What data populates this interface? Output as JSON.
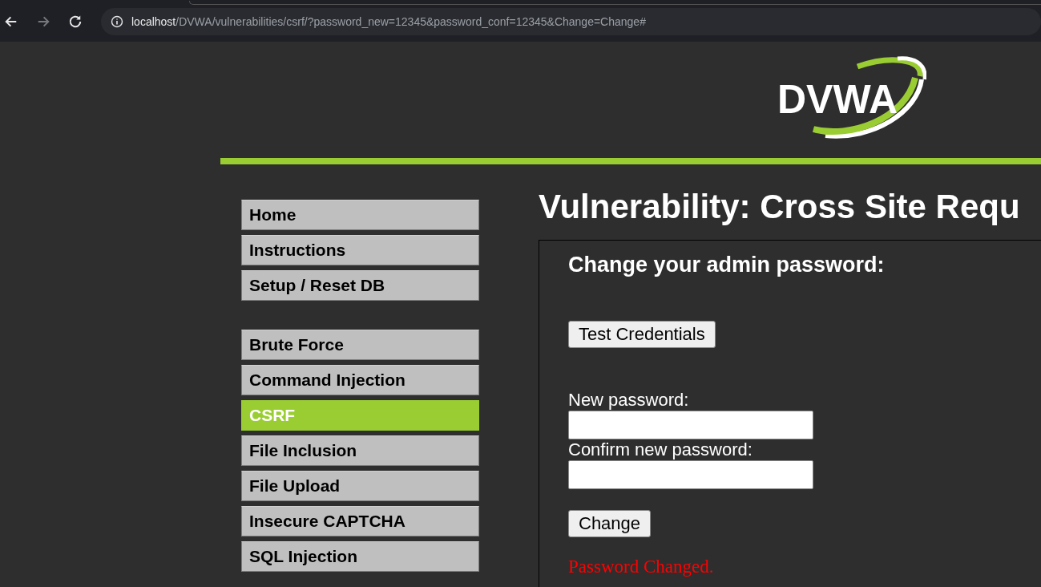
{
  "browser": {
    "url_host": "localhost",
    "url_path": "/DVWA/vulnerabilities/csrf/?password_new=12345&password_conf=12345&Change=Change#",
    "forward_disabled": true
  },
  "logo": {
    "text": "DVWA"
  },
  "sidebar": {
    "groups": [
      [
        {
          "label": "Home",
          "selected": false
        },
        {
          "label": "Instructions",
          "selected": false
        },
        {
          "label": "Setup / Reset DB",
          "selected": false
        }
      ],
      [
        {
          "label": "Brute Force",
          "selected": false
        },
        {
          "label": "Command Injection",
          "selected": false
        },
        {
          "label": "CSRF",
          "selected": true
        },
        {
          "label": "File Inclusion",
          "selected": false
        },
        {
          "label": "File Upload",
          "selected": false
        },
        {
          "label": "Insecure CAPTCHA",
          "selected": false
        },
        {
          "label": "SQL Injection",
          "selected": false
        }
      ]
    ]
  },
  "main": {
    "title": "Vulnerability: Cross Site Requ",
    "form_title": "Change your admin password:",
    "test_button": "Test Credentials",
    "fields": [
      {
        "label": "New password:"
      },
      {
        "label": "Confirm new password:"
      }
    ],
    "submit_button": "Change",
    "message": "Password Changed."
  }
}
